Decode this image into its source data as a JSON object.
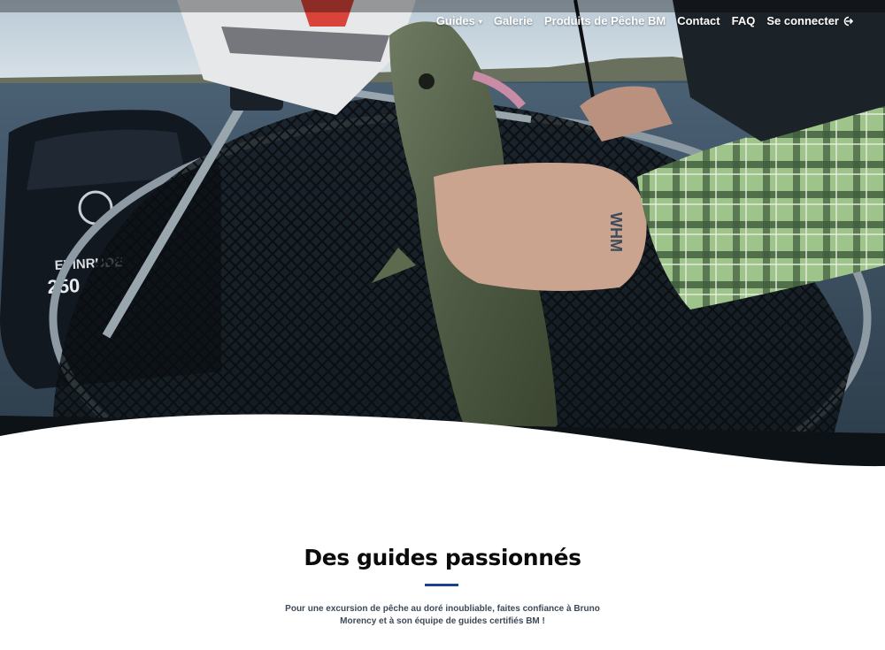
{
  "nav": {
    "items": [
      {
        "label": "Guides",
        "has_dropdown": true
      },
      {
        "label": "Galerie",
        "has_dropdown": false
      },
      {
        "label": "Produits de Pêche BM",
        "has_dropdown": false
      },
      {
        "label": "Contact",
        "has_dropdown": false
      },
      {
        "label": "FAQ",
        "has_dropdown": false
      },
      {
        "label": "Se connecter",
        "has_dropdown": false,
        "icon": "login-icon"
      }
    ],
    "dropdown_icon": "chevron-down-icon"
  },
  "hero": {
    "image": "fisherman-holding-walleye-in-net",
    "motor_brand": "EVINRUDE",
    "motor_model": "250",
    "tattoo_text": "WHM"
  },
  "section": {
    "title": "Des guides passionnés",
    "text": "Pour une excursion de pêche au doré inoubliable, faites confiance à Bruno Morency et à son équipe de guides certifiés BM !",
    "accent_color": "#1d3f91"
  }
}
